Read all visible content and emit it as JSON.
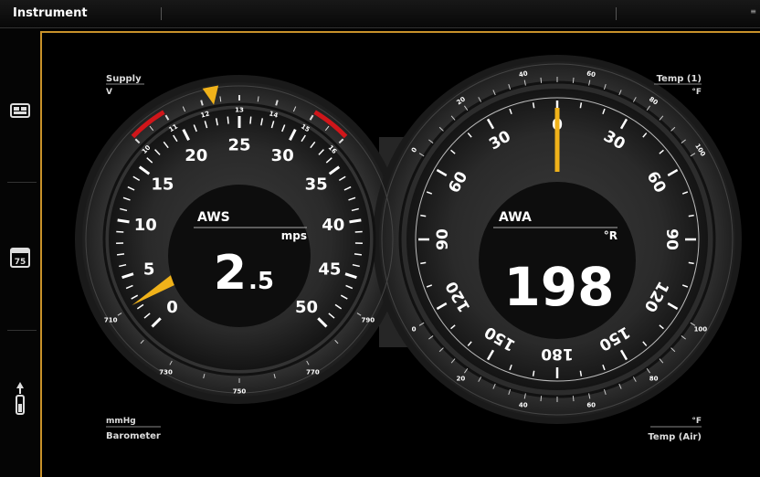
{
  "app_title": "Instrument",
  "sidebar_icons": [
    "gauges-icon",
    "calendar-icon",
    "keel-icon"
  ],
  "calendar_icon_text": "75",
  "aws": {
    "label": "AWS",
    "unit": "mps",
    "value_main": "2",
    "value_decimal": ".5",
    "value": 2.5,
    "scale_labels": [
      "0",
      "5",
      "10",
      "15",
      "20",
      "25",
      "30",
      "35",
      "40",
      "45",
      "50"
    ]
  },
  "awa": {
    "label": "AWA",
    "unit": "°R",
    "value": "198",
    "scale_labels_left": [
      "30",
      "60",
      "90",
      "120",
      "150"
    ],
    "scale_labels_right": [
      "30",
      "60",
      "90",
      "120",
      "150"
    ],
    "top_label": "0",
    "bottom_label": "180"
  },
  "supply": {
    "title": "Supply",
    "unit": "V",
    "ticks": [
      "10",
      "11",
      "12",
      "13",
      "14",
      "15",
      "16"
    ],
    "value": 12.3
  },
  "barometer": {
    "title": "Barometer",
    "unit": "mmHg",
    "ticks": [
      "710",
      "730",
      "750",
      "770",
      "790"
    ]
  },
  "temp1": {
    "title": "Temp (1)",
    "unit": "°F",
    "ticks": [
      "0",
      "20",
      "40",
      "60",
      "80",
      "100"
    ]
  },
  "temp_air": {
    "title": "Temp (Air)",
    "unit": "°F",
    "ticks": [
      "0",
      "20",
      "40",
      "60",
      "80",
      "100"
    ]
  },
  "colors": {
    "accent": "#c8912a",
    "needle": "#f0b21a",
    "warning": "#d0161a"
  }
}
